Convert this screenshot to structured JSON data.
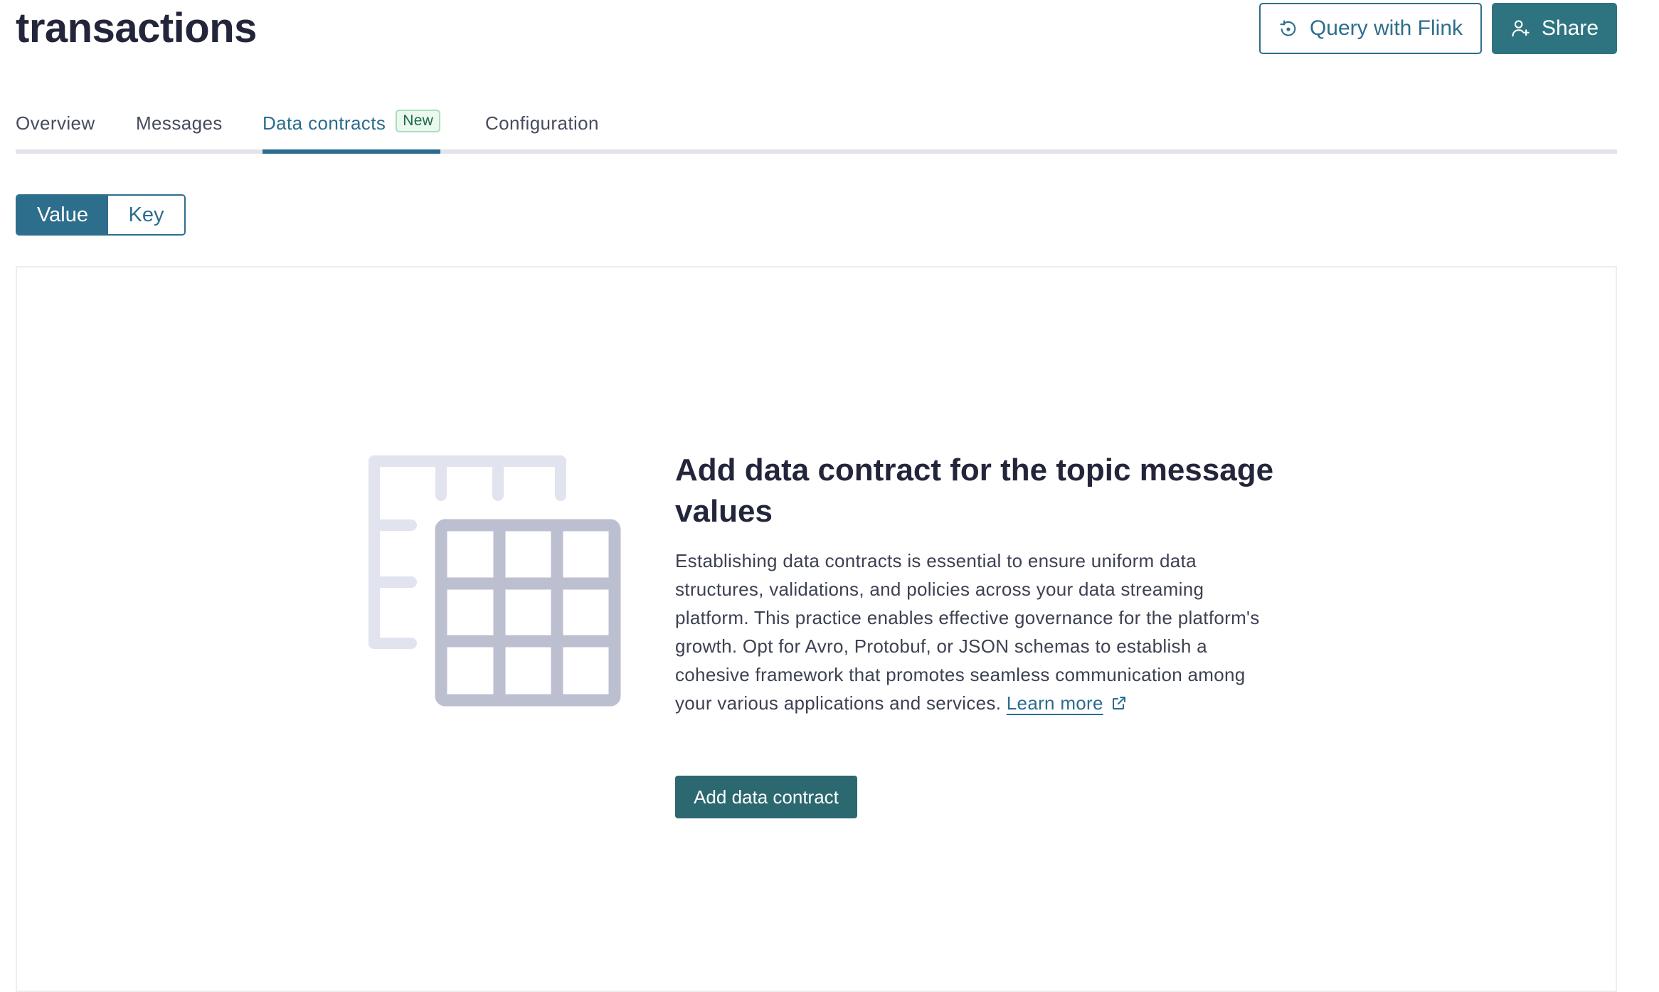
{
  "page": {
    "title": "transactions"
  },
  "header": {
    "query_label": "Query with Flink",
    "share_label": "Share",
    "query_icon": "flink-icon",
    "share_icon": "add-user-icon"
  },
  "tabs": [
    {
      "label": "Overview",
      "active": false
    },
    {
      "label": "Messages",
      "active": false
    },
    {
      "label": "Data contracts",
      "active": true,
      "badge": "New"
    },
    {
      "label": "Configuration",
      "active": false
    }
  ],
  "toggle": {
    "value_label": "Value",
    "key_label": "Key",
    "selected": "Value"
  },
  "empty_state": {
    "title": "Add data contract for the topic message values",
    "description": "Establishing data contracts is essential to ensure uniform data structures, validations, and policies across your data streaming platform. This practice enables effective governance for the platform's growth. Opt for Avro, Protobuf, or JSON schemas to establish a cohesive framework that promotes seamless communication among your various applications and services.",
    "link_label": "Learn more",
    "button_label": "Add data contract",
    "illustration_icon": "table-grid-icon",
    "link_icon": "external-link-icon"
  },
  "colors": {
    "primary": "#2d6e8d",
    "primary_dark": "#2b6870",
    "badge_green": "#1f6b45",
    "illustration_light": "#e1e3ee",
    "illustration_dark": "#bcbfd0"
  }
}
